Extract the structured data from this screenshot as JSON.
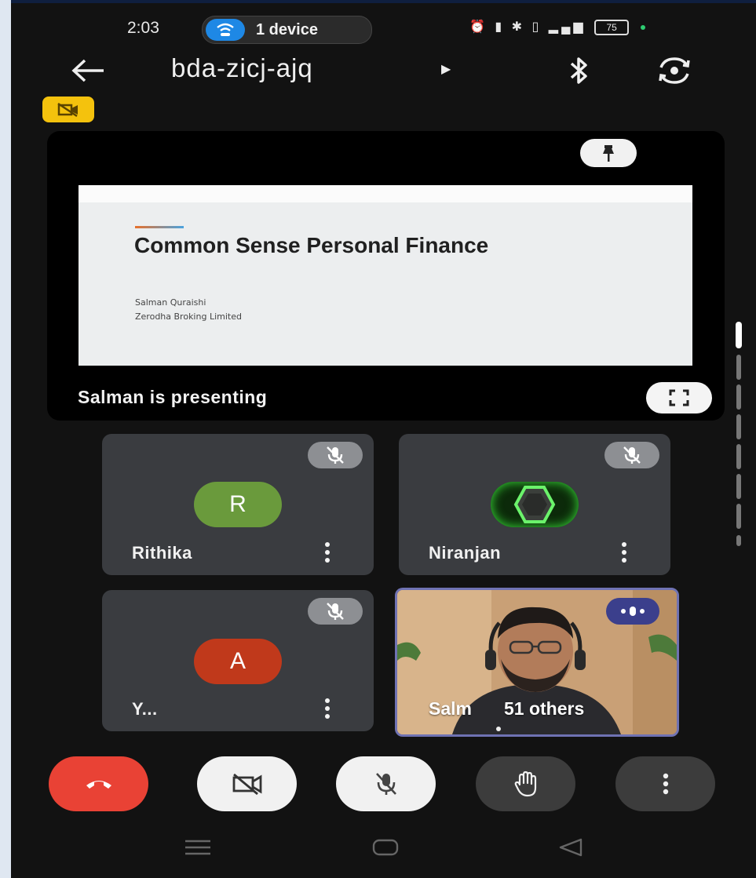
{
  "status_bar": {
    "time": "2:03",
    "cast_label": "1 device",
    "battery": "75"
  },
  "header": {
    "meeting_code": "bda-zicj-ajq"
  },
  "presentation": {
    "slide_title": "Common Sense Personal Finance",
    "slide_author": "Salman Quraishi",
    "slide_company": "Zerodha Broking Limited",
    "caption": "Salman is presenting"
  },
  "participants": [
    {
      "name": "Rithika",
      "initial": "R",
      "color": "#6a9a3c",
      "muted": true
    },
    {
      "name": "Niranjan",
      "initial": "",
      "muted": true
    },
    {
      "name": "Y...",
      "initial": "A",
      "color": "#c0391b",
      "muted": true
    }
  ],
  "active_speaker": {
    "name": "Salm",
    "others_label": "51 others"
  },
  "colors": {
    "end_call": "#e94235",
    "control_light": "#f1f1f1",
    "control_dark": "#3c3c3c",
    "tile_bg": "#3a3c40",
    "highlight": "#f4c20d"
  }
}
